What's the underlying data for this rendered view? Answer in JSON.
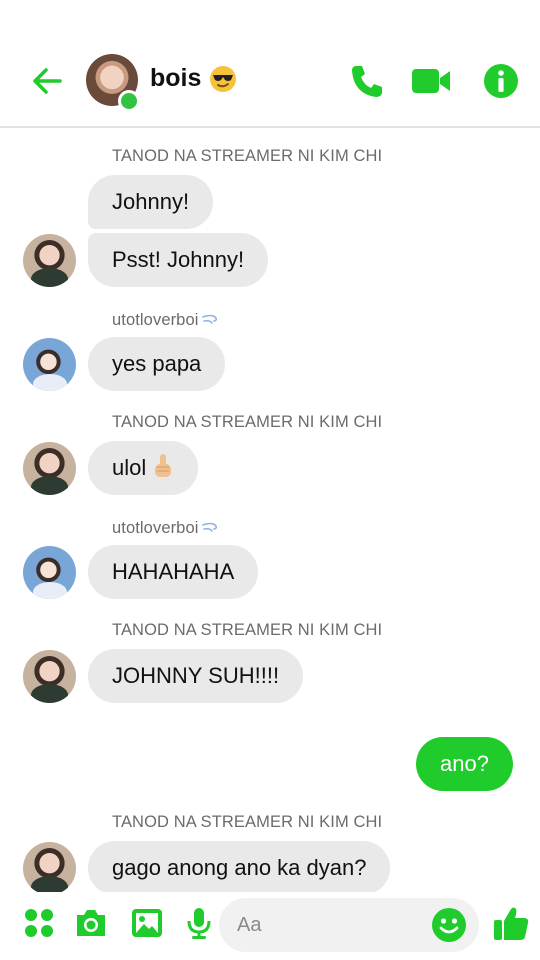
{
  "header": {
    "title": "bois",
    "accent_color": "#1fcc2c",
    "icons": [
      "back-arrow-icon",
      "phone-icon",
      "video-camera-icon",
      "info-icon",
      "sunglasses-emoji-icon"
    ]
  },
  "messages": [
    {
      "sender": "TANOD NA STREAMER NI KIM CHI",
      "text": "Johnny!"
    },
    {
      "text": "Psst! Johnny!"
    },
    {
      "sender": "utotloverboi",
      "text": "yes papa"
    },
    {
      "sender": "TANOD NA STREAMER NI KIM CHI",
      "text": "ulol"
    },
    {
      "sender": "utotloverboi",
      "text": "HAHAHAHA"
    },
    {
      "sender": "TANOD NA STREAMER NI KIM CHI",
      "text": "JOHNNY SUH!!!!"
    },
    {
      "text": "ano?"
    },
    {
      "sender": "TANOD NA STREAMER NI KIM CHI",
      "text": "gago anong ano ka dyan?"
    }
  ],
  "compose": {
    "placeholder": "Aa",
    "icons": [
      "apps-grid-icon",
      "camera-icon",
      "gallery-icon",
      "microphone-icon",
      "emoji-smile-icon",
      "thumbs-up-icon"
    ]
  }
}
